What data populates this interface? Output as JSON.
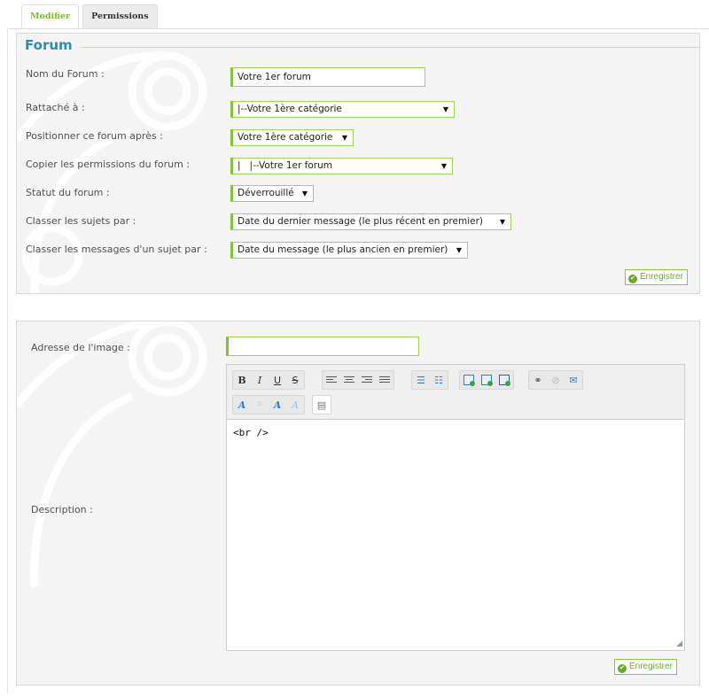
{
  "tabs": [
    {
      "label": "Modifier",
      "active": true
    },
    {
      "label": "Permissions",
      "active": false
    }
  ],
  "forum_panel": {
    "legend": "Forum",
    "fields": {
      "name_label": "Nom du Forum :",
      "name_value": "Votre 1er forum",
      "parent_label": "Rattaché à :",
      "parent_value": "|--Votre 1ère catégorie",
      "position_label": "Positionner ce forum après :",
      "position_value": "Votre 1ère catégorie",
      "copy_perm_label": "Copier les permissions du forum :",
      "copy_perm_value": "|   |--Votre 1er forum",
      "status_label": "Statut du forum :",
      "status_value": "Déverrouillé",
      "sort_topics_label": "Classer les sujets par :",
      "sort_topics_value": "Date du dernier message (le plus récent en premier)",
      "sort_posts_label": "Classer les messages d'un sujet par :",
      "sort_posts_value": "Date du message (le plus ancien en premier)"
    },
    "save_label": "Enregistrer"
  },
  "description_panel": {
    "image_label": "Adresse de l'image :",
    "image_value": "",
    "description_label": "Description :",
    "editor_content": "<br />",
    "save_label": "Enregistrer"
  },
  "colors": {
    "accent_green": "#80c33a",
    "legend_blue": "#2d8bb5"
  },
  "toolbar_icons": [
    "bold-icon",
    "italic-icon",
    "underline-icon",
    "strike-icon",
    "align-left-icon",
    "align-center-icon",
    "align-right-icon",
    "justify-icon",
    "bullet-list-icon",
    "numbered-list-icon",
    "image-icon",
    "image-copy-icon",
    "image-save-icon",
    "link-icon",
    "unlink-icon",
    "email-icon",
    "font-color-icon",
    "background-color-icon",
    "font-face-icon",
    "clear-format-icon",
    "source-icon"
  ]
}
